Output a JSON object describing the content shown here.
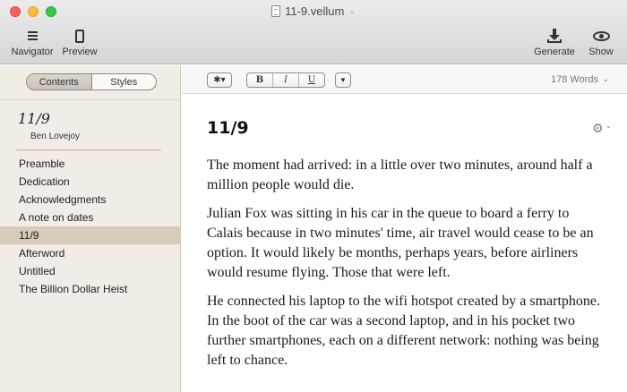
{
  "window": {
    "title": "11-9.vellum",
    "title_chevron": "⌄"
  },
  "toolbar": {
    "navigator_label": "Navigator",
    "preview_label": "Preview",
    "generate_label": "Generate",
    "show_label": "Show"
  },
  "sidebar": {
    "tabs": [
      {
        "label": "Contents",
        "active": true
      },
      {
        "label": "Styles",
        "active": false
      }
    ],
    "book_title": "11/9",
    "book_author": "Ben Lovejoy",
    "items": [
      {
        "label": "Preamble",
        "selected": false
      },
      {
        "label": "Dedication",
        "selected": false
      },
      {
        "label": "Acknowledgments",
        "selected": false
      },
      {
        "label": "A note on dates",
        "selected": false
      },
      {
        "label": "11/9",
        "selected": true
      },
      {
        "label": "Afterword",
        "selected": false
      },
      {
        "label": "Untitled",
        "selected": false
      },
      {
        "label": "The Billion Dollar Heist",
        "selected": false
      }
    ]
  },
  "format_bar": {
    "style_label": "✱▾",
    "bold_label": "B",
    "italic_label": "I",
    "underline_label": "U",
    "more_label": "▼",
    "word_count": "178 Words",
    "word_count_chevron": "⌄"
  },
  "editor": {
    "chapter_title": "11/9",
    "gear_glyph": "⚙",
    "gear_chevron": "⌄",
    "paragraphs": [
      "The moment had arrived: in a little over two minutes, around half a million people would die.",
      "Julian Fox was sitting in his car in the queue to board a ferry to Calais because in two minutes' time, air travel would cease to be an option. It would likely be months, perhaps years, before airliners would resume flying. Those that were left.",
      "He connected his laptop to the wifi hotspot created by a smartphone. In the boot of the car was a second laptop, and in his pocket two further smartphones, each on a different network: nothing was being left to chance."
    ]
  },
  "colors": {
    "sidebar_bg": "#f1ece5",
    "sidebar_selected": "#d7cbba",
    "close": "#fc605c",
    "minimize": "#fdbc40",
    "maximize": "#34c84a"
  }
}
